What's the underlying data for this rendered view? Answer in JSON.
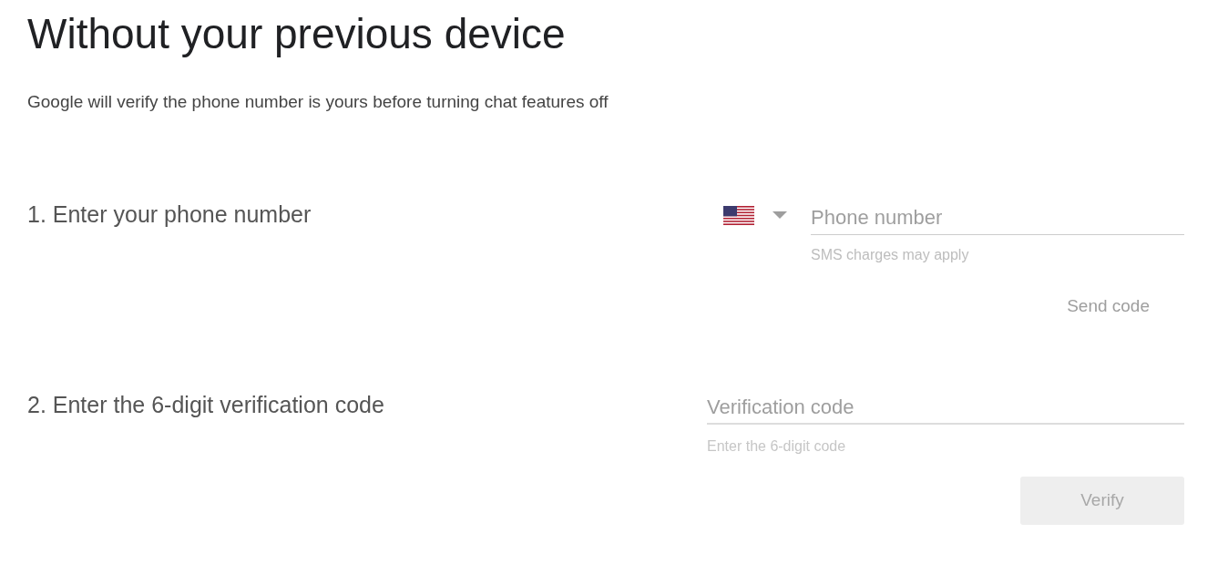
{
  "title": "Without your previous device",
  "subtitle": "Google will verify the phone number is yours before turning chat features off",
  "steps": [
    {
      "label": "1. Enter your phone number",
      "kind": "phone",
      "field": {
        "placeholder": "Phone number"
      },
      "helper": "SMS charges may apply",
      "button": {
        "label": "Send code",
        "disabled": true
      }
    },
    {
      "label": "2. Enter the 6-digit verification code",
      "kind": "code",
      "field": {
        "placeholder": "Verification code"
      },
      "helper": "Enter the 6-digit code",
      "button": {
        "label": "Verify",
        "disabled": true
      }
    }
  ]
}
